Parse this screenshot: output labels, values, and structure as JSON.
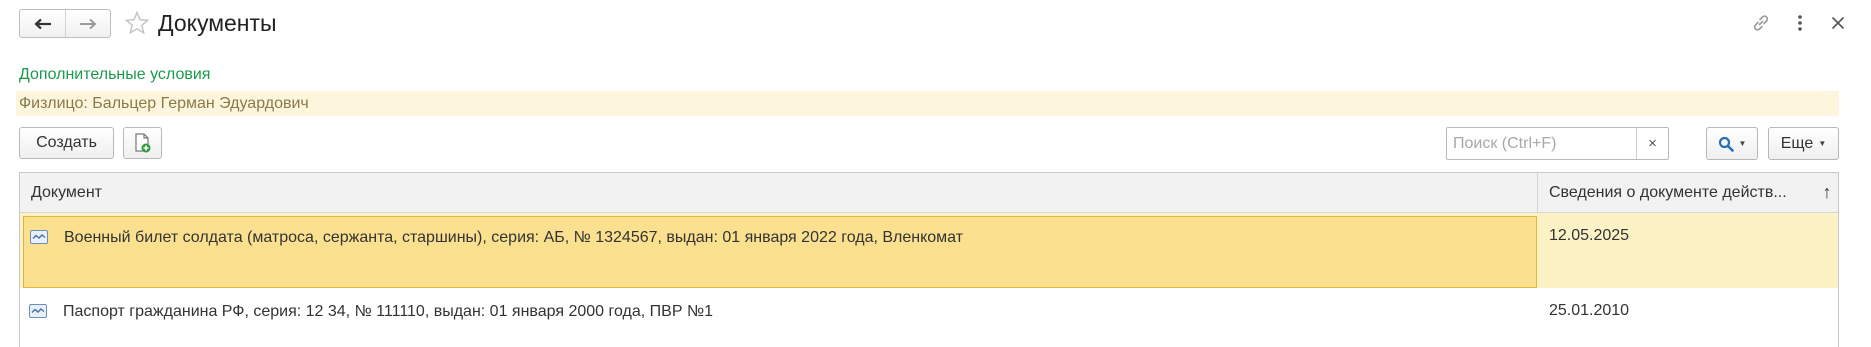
{
  "window": {
    "title": "Документы",
    "back_icon": "arrow-left-icon",
    "forward_icon": "arrow-right-icon",
    "favorite_icon": "star-icon",
    "link_icon": "link-icon",
    "menu_icon": "more-vertical-icon",
    "close_icon": "close-icon"
  },
  "conditions": {
    "link_label": "Дополнительные условия",
    "filter_text": "Физлицо: Бальцер Герман Эдуардович"
  },
  "toolbar": {
    "create_label": "Создать",
    "new_doc_icon": "new-document-icon",
    "search_placeholder": "Поиск (Ctrl+F)",
    "search_value": "",
    "clear_label": "×",
    "find_icon": "search-icon",
    "more_label": "Еще"
  },
  "table": {
    "columns": [
      {
        "label": "Документ"
      },
      {
        "label": "Сведения о документе действ..."
      }
    ],
    "sort_indicator": "↑",
    "rows": [
      {
        "document": "Военный билет солдата (матроса, сержанта, старшины), серия: АБ, № 1324567, выдан: 01 января 2022 года, Вленкомат",
        "date": "12.05.2025",
        "selected": true
      },
      {
        "document": "Паспорт гражданина РФ, серия: 12 34, № 111110, выдан: 01 января 2000 года, ПВР №1",
        "date": "25.01.2010",
        "selected": false
      }
    ]
  },
  "colors": {
    "accent_green": "#1c9a4c",
    "filter_bg": "#fdf6dc",
    "selected_row": "#fdf2c6",
    "selected_cell": "#fbe08f",
    "selected_border": "#e2b53c",
    "find_icon": "#2b6fb3"
  }
}
